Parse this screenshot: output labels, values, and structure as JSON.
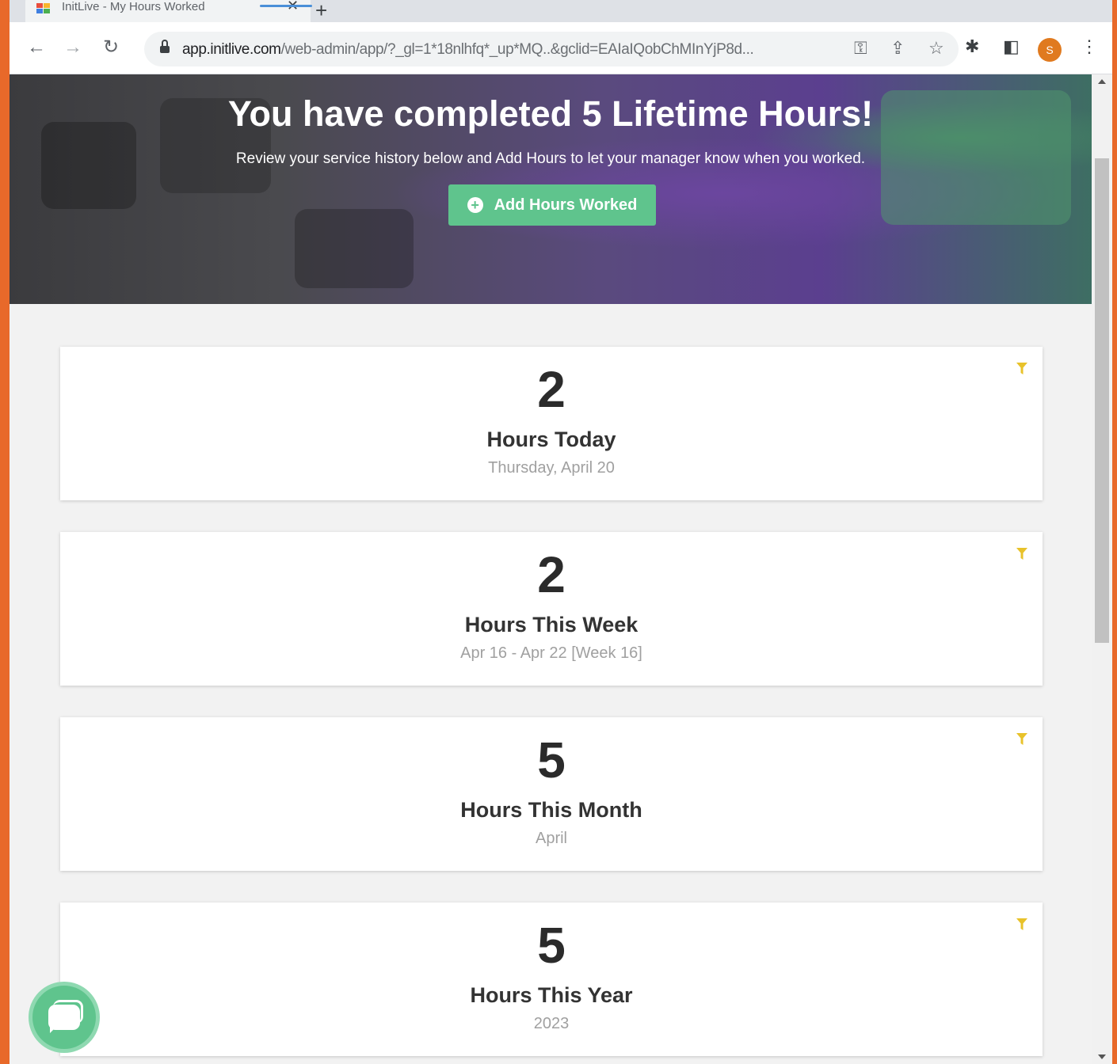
{
  "browser": {
    "tab_title": "InitLive - My Hours Worked",
    "tab_close": "✕",
    "new_tab": "+",
    "url_host": "app.initlive.com",
    "url_path": "/web-admin/app/?_gl=1*18nlhfq*_up*MQ..&gclid=EAIaIQobChMInYjP8d...",
    "profile_initial": "S",
    "icons": [
      "back-arrow-icon",
      "forward-arrow-icon",
      "reload-icon",
      "lock-icon",
      "key-icon",
      "share-icon",
      "star-icon",
      "extensions-icon",
      "side-panel-icon",
      "menu-icon"
    ]
  },
  "hero": {
    "title": "You have completed 5 Lifetime Hours!",
    "subtitle": "Review your service history below and Add Hours to let your manager know when you worked.",
    "add_button_label": "Add Hours Worked"
  },
  "cards": [
    {
      "value": "2",
      "label": "Hours Today",
      "sub": "Thursday, April 20"
    },
    {
      "value": "2",
      "label": "Hours This Week",
      "sub": "Apr 16 - Apr 22  [Week 16]"
    },
    {
      "value": "5",
      "label": "Hours This Month",
      "sub": "April"
    },
    {
      "value": "5",
      "label": "Hours This Year",
      "sub": "2023"
    }
  ],
  "colors": {
    "frame": "#e8692a",
    "accent_green": "#5fc48d",
    "filter_yellow": "#e8c22a",
    "hero_purple": "#5b3f8f"
  }
}
